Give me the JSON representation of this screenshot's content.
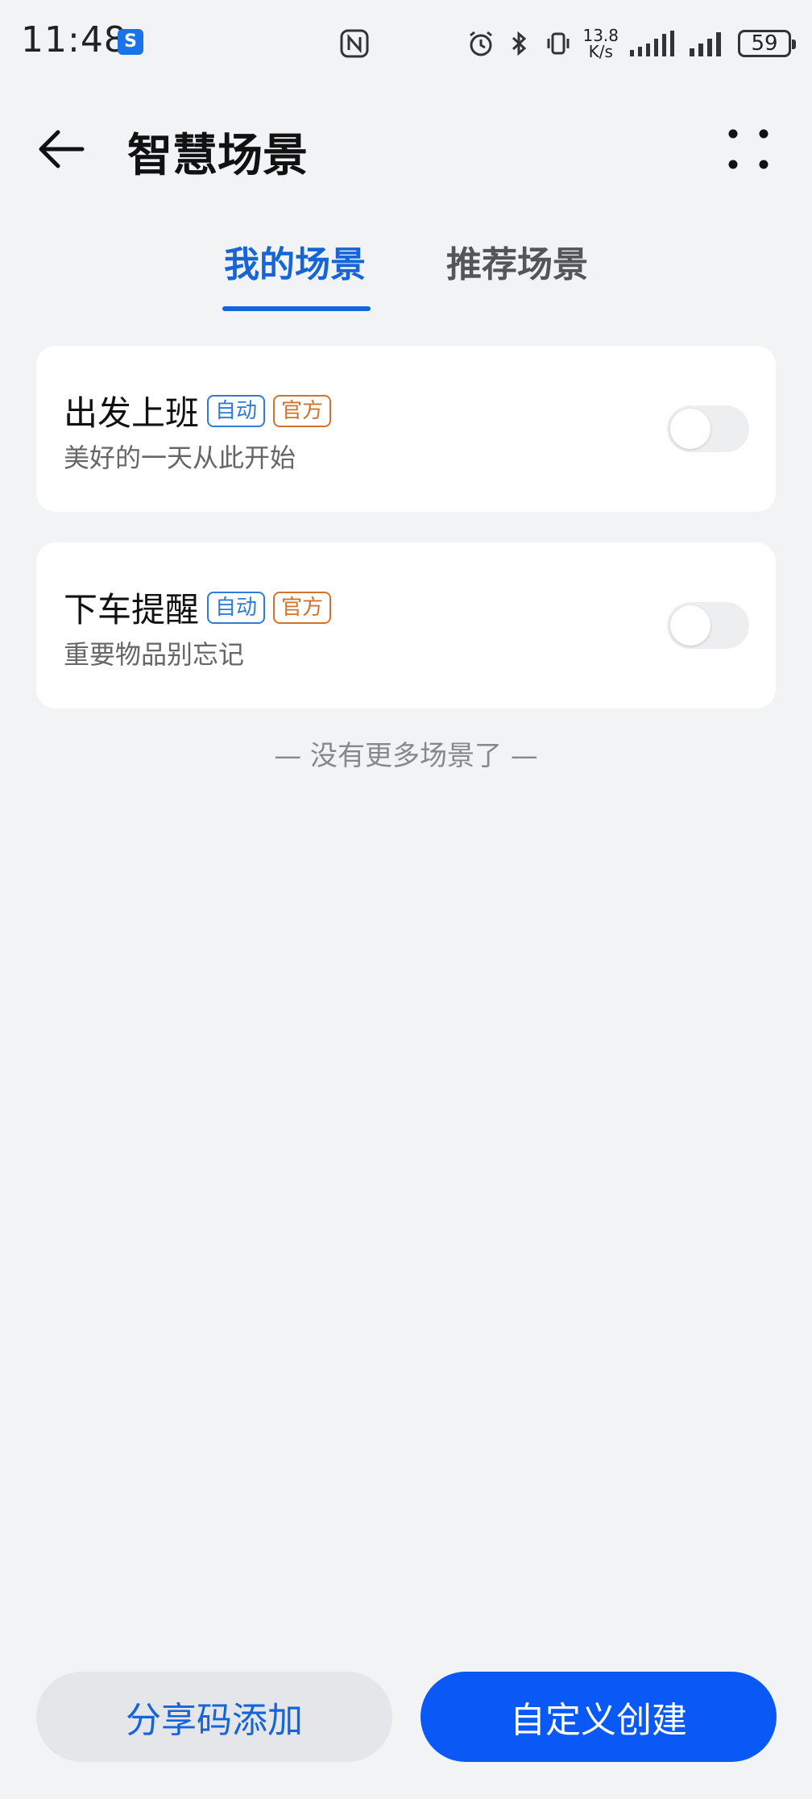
{
  "status_bar": {
    "time": "11:48",
    "app_icon": "S",
    "speed_value": "13.8",
    "speed_unit": "K/s",
    "battery": "59",
    "icons": [
      "nfc-icon",
      "alarm-icon",
      "bluetooth-icon",
      "vibrate-icon",
      "signal-icon",
      "signal-icon"
    ]
  },
  "header": {
    "title": "智慧场景",
    "back_icon": "arrow-left-icon",
    "more_icon": "more-dots-icon"
  },
  "tabs": [
    {
      "label": "我的场景",
      "active": true
    },
    {
      "label": "推荐场景",
      "active": false
    }
  ],
  "scenes": [
    {
      "title": "出发上班",
      "badges": [
        "自动",
        "官方"
      ],
      "subtitle": "美好的一天从此开始",
      "enabled": false
    },
    {
      "title": "下车提醒",
      "badges": [
        "自动",
        "官方"
      ],
      "subtitle": "重要物品别忘记",
      "enabled": false
    }
  ],
  "no_more_text": "— 没有更多场景了 —",
  "buttons": {
    "share_label": "分享码添加",
    "create_label": "自定义创建"
  },
  "colors": {
    "accent": "#1565d8",
    "primary_button": "#0a59f7",
    "background": "#f1f3f5",
    "badge_auto": "#2f7bd8",
    "badge_official": "#d2732c"
  }
}
